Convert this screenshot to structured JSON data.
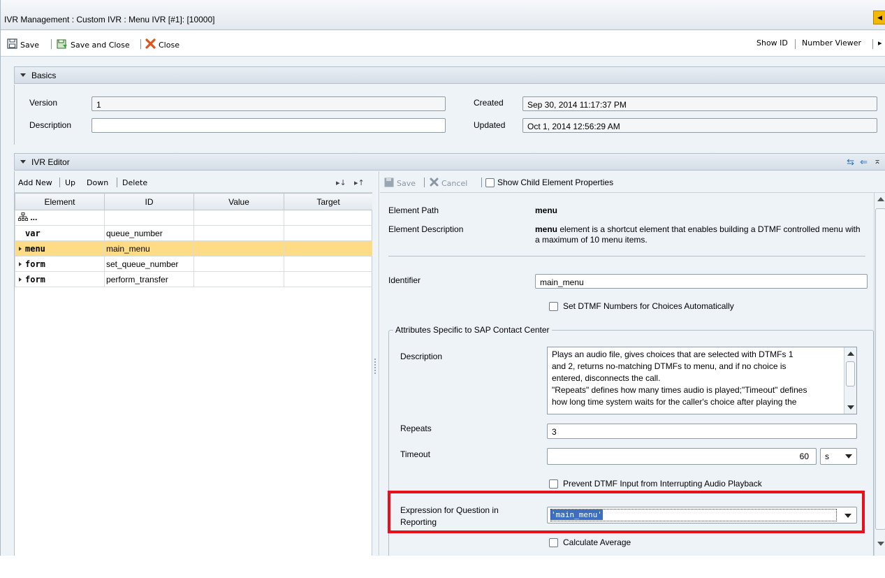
{
  "window": {
    "title": "IVR Management : Custom IVR : Menu IVR [#1]: [10000]"
  },
  "toolbar": {
    "save_label": "Save",
    "save_close_label": "Save and Close",
    "close_label": "Close",
    "show_id_label": "Show ID",
    "number_viewer_label": "Number Viewer"
  },
  "basics": {
    "header": "Basics",
    "version_label": "Version",
    "version_value": "1",
    "description_label": "Description",
    "description_value": "",
    "created_label": "Created",
    "created_value": "Sep 30, 2014 11:17:37 PM",
    "updated_label": "Updated",
    "updated_value": "Oct 1, 2014 12:56:29 AM"
  },
  "editor": {
    "header": "IVR Editor",
    "left_toolbar": {
      "add_new": "Add New",
      "up": "Up",
      "down": "Down",
      "delete": "Delete"
    },
    "columns": [
      "Element",
      "ID",
      "Value",
      "Target"
    ],
    "rows": [
      {
        "element": "...",
        "id": "",
        "value": "",
        "target": ""
      },
      {
        "element": "var",
        "id": "queue_number",
        "value": "",
        "target": ""
      },
      {
        "element": "menu",
        "id": "main_menu",
        "value": "",
        "target": ""
      },
      {
        "element": "form",
        "id": "set_queue_number",
        "value": "",
        "target": ""
      },
      {
        "element": "form",
        "id": "perform_transfer",
        "value": "",
        "target": ""
      }
    ],
    "right_toolbar": {
      "save": "Save",
      "cancel": "Cancel",
      "show_child": "Show Child Element Properties"
    },
    "props": {
      "element_path_label": "Element Path",
      "element_path_value": "menu",
      "element_desc_label": "Element Description",
      "element_desc_bold": "menu",
      "element_desc_text": " element is a shortcut element that enables building a DTMF controlled menu with a maximum of 10 menu items.",
      "identifier_label": "Identifier",
      "identifier_value": "main_menu",
      "set_dtmf_label": "Set DTMF Numbers for Choices Automatically",
      "fieldset_legend": "Attributes Specific to SAP Contact Center",
      "description_label": "Description",
      "description_line1": "Plays an audio file, gives choices that are selected with DTMFs 1",
      "description_line2": "and 2, returns no-matching DTMFs to menu, and if no choice is",
      "description_line3": "entered, disconnects the call.",
      "description_line4": "\"Repeats\" defines how many times audio is played;\"Timeout\" defines",
      "description_line5": "how long time system waits for the caller's choice after playing the",
      "repeats_label": "Repeats",
      "repeats_value": "3",
      "timeout_label": "Timeout",
      "timeout_value": "60",
      "timeout_unit": "s",
      "prevent_dtmf_label": "Prevent DTMF Input from Interrupting Audio Playback",
      "expression_label_line1": "Expression for Question in",
      "expression_label_line2": "Reporting",
      "expression_value": "'main_menu'",
      "calc_avg_label": "Calculate Average"
    }
  },
  "colors": {
    "selected_row": "#fddc85",
    "highlight_box": "#e8111b",
    "selection_text_bg": "#3a6fc4"
  }
}
